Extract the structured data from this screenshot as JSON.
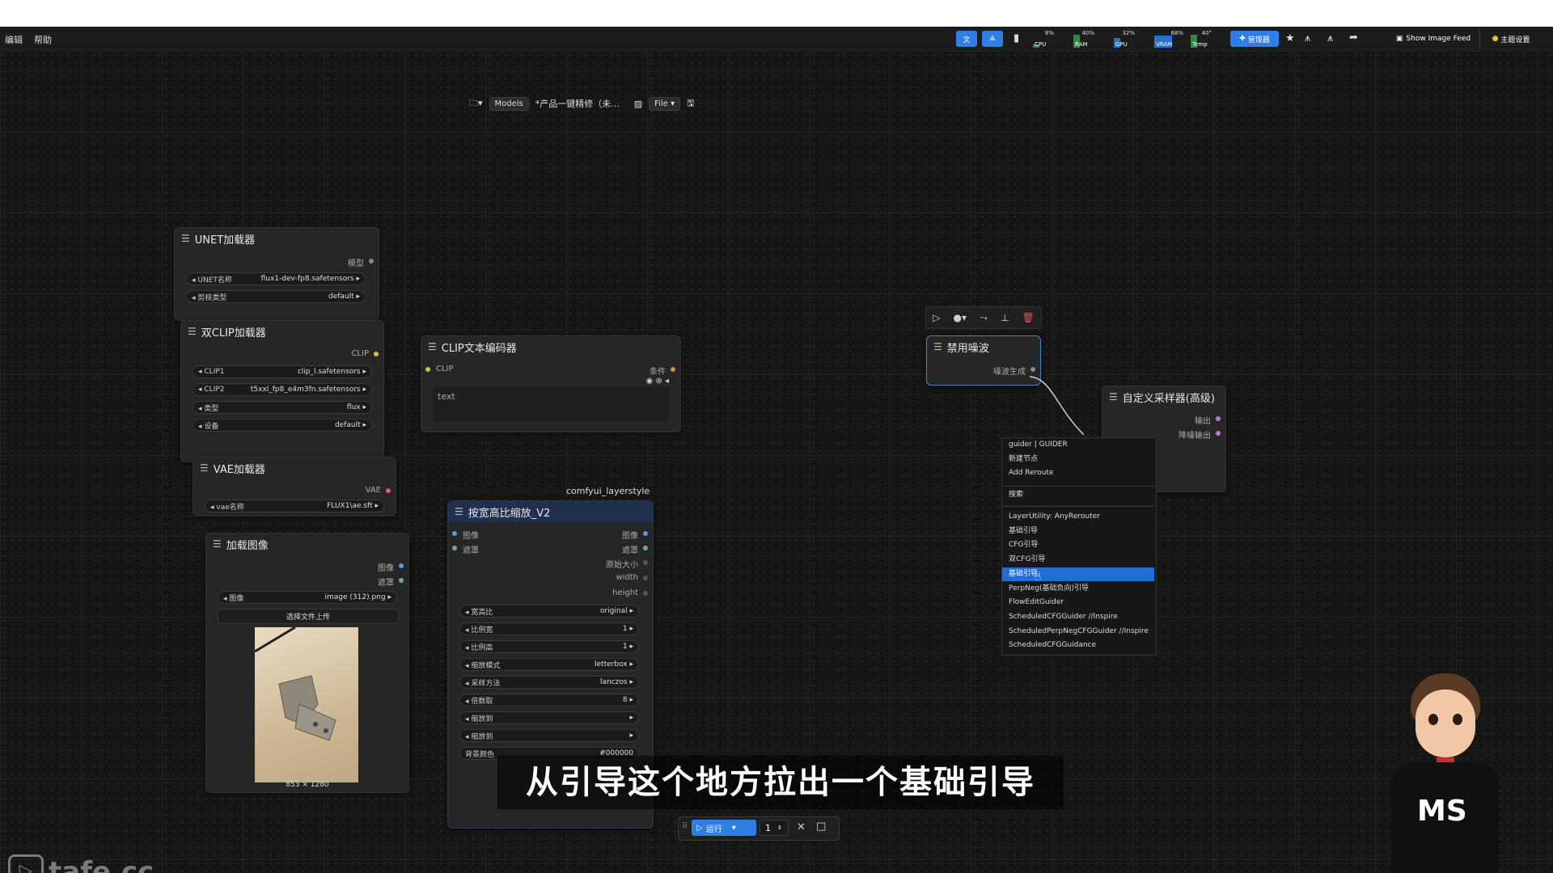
{
  "menu": {
    "edit": "编辑",
    "help": "帮助"
  },
  "topbar": {
    "monitors": [
      {
        "label": "CPU",
        "pct": "8%"
      },
      {
        "label": "RAM",
        "pct": "40%"
      },
      {
        "label": "GPU",
        "pct": "32%"
      },
      {
        "label": "VRAM",
        "pct": "68%"
      },
      {
        "label": "Temp",
        "pct": "40°"
      }
    ],
    "manager_label": "管理器",
    "show_image_feed": "Show Image Feed",
    "theme_settings": "主题设置"
  },
  "workflow_bar": {
    "models": "Models",
    "title": "*产品一键精修（未...",
    "file": "File"
  },
  "nodes": {
    "unet": {
      "title": "UNET加载器",
      "output": "模型",
      "widgets": [
        {
          "label": "UNET名称",
          "value": "flux1-dev-fp8.safetensors"
        },
        {
          "label": "剪枝类型",
          "value": "default"
        }
      ]
    },
    "dualclip": {
      "title": "双CLIP加载器",
      "output": "CLIP",
      "widgets": [
        {
          "label": "CLIP1",
          "value": "clip_l.safetensors"
        },
        {
          "label": "CLIP2",
          "value": "t5xxl_fp8_e4m3fn.safetensors"
        },
        {
          "label": "类型",
          "value": "flux"
        },
        {
          "label": "设备",
          "value": "default"
        }
      ]
    },
    "clipencode": {
      "title": "CLIP文本编码器",
      "input": "CLIP",
      "output": "条件",
      "text": "text"
    },
    "vae": {
      "title": "VAE加载器",
      "output": "VAE",
      "widgets": [
        {
          "label": "vae名称",
          "value": "FLUX1\\ae.sft"
        }
      ]
    },
    "loadimage": {
      "title": "加载图像",
      "outputs": [
        "图像",
        "遮罩"
      ],
      "widgets": [
        {
          "label": "图像",
          "value": "image (312).png"
        }
      ],
      "upload": "选择文件上传",
      "dims": "853 × 1280"
    },
    "scale": {
      "group": "comfyui_layerstyle",
      "title": "按宽高比缩放_V2",
      "inputs": [
        "图像",
        "遮罩"
      ],
      "outputs": [
        "图像",
        "遮罩",
        "原始大小",
        "width",
        "height"
      ],
      "widgets": [
        {
          "label": "宽高比",
          "value": "original"
        },
        {
          "label": "比例宽",
          "value": "1"
        },
        {
          "label": "比例高",
          "value": "1"
        },
        {
          "label": "缩放模式",
          "value": "letterbox"
        },
        {
          "label": "采样方法",
          "value": "lanczos"
        },
        {
          "label": "倍数取",
          "value": "8"
        },
        {
          "label": "缩放到",
          "value": ""
        },
        {
          "label": "缩放到",
          "value": ""
        },
        {
          "label": "背景颜色",
          "value": "#000000"
        }
      ]
    },
    "disablenoise": {
      "title": "禁用噪波",
      "output": "噪波生成"
    },
    "sampler": {
      "title": "自定义采样器(高级)",
      "outputs": [
        "输出",
        "降噪输出"
      ]
    }
  },
  "context_menu": {
    "header": "guider | GUIDER",
    "items": [
      "新建节点",
      "Add Reroute"
    ],
    "search": "搜索",
    "list": [
      "LayerUtility: AnyRerouter",
      "基础引导",
      "CFG引导",
      "双CFG引导",
      "基础引导",
      "PerpNeg(基础负向)引导",
      "FlowEditGuider",
      "ScheduledCFGGuider //Inspire",
      "ScheduledPerpNegCFGGuider //Inspire",
      "ScheduledCFGGuidance"
    ],
    "selected_index": 4
  },
  "subtitle": "从引导这个地方拉出一个基础引导",
  "runbar": {
    "run": "运行",
    "count": "1"
  },
  "watermark": "tafe.cc",
  "avatar_shirt": "MS"
}
